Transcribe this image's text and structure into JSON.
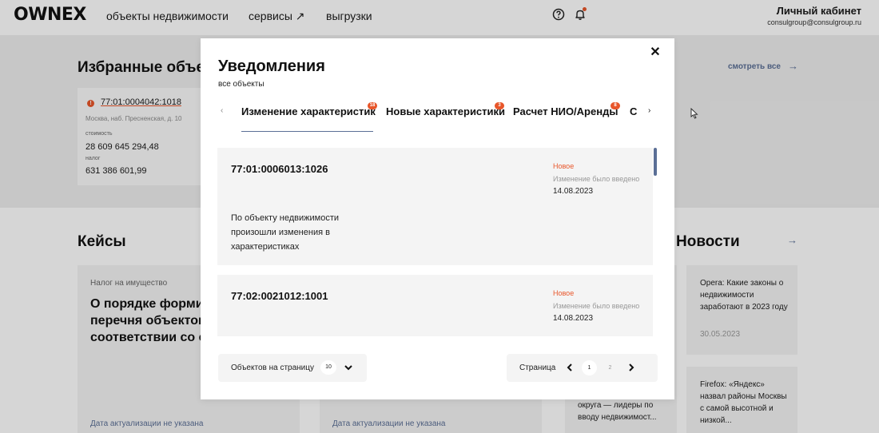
{
  "header": {
    "logo": "OWNEX",
    "nav": [
      "объекты недвижимости",
      "сервисы ↗",
      "выгрузки"
    ],
    "cabinet_title": "Личный кабинет",
    "cabinet_email": "consulgroup@consulgroup.ru",
    "icons": [
      "help-circle-icon",
      "bell-icon"
    ]
  },
  "favorites": {
    "title": "Избранные объекты",
    "see_all": "смотреть все",
    "card": {
      "cadastral": "77:01:0004042:1018",
      "address": "Москва, наб. Пресненская, д. 10",
      "cost_label": "стоимость",
      "cost": "28 609 645 294,48",
      "tax_label": "налог",
      "tax": "631 386 601,99"
    }
  },
  "cases": {
    "title": "Кейсы",
    "cards": [
      {
        "tag": "Налог на имущество",
        "text": "О порядке формирования перечня объектов, в соответствии со статьей",
        "date": "Дата актуализации не указана"
      },
      {
        "tag": "",
        "text": "",
        "date": "Дата актуализации не указана"
      },
      {
        "text": "округа — лидеры по вводу недвижимост..."
      }
    ]
  },
  "news": {
    "title": "Новости",
    "cards": [
      {
        "text": "Opera: Какие законы о недвижимости заработают в 2023 году",
        "date": "30.05.2023"
      },
      {
        "text": "Firefox: «Яндекс» назвал районы Москвы с самой высотной и низкой..."
      }
    ]
  },
  "modal": {
    "title": "Уведомления",
    "subtitle": "все объекты",
    "tabs": [
      {
        "label": "Изменение характеристик",
        "badge": "18",
        "active": true
      },
      {
        "label": "Новые характеристики",
        "badge": "3"
      },
      {
        "label": "Расчет НИО/Аренды",
        "badge": "8"
      },
      {
        "label": "С"
      }
    ],
    "notifications": [
      {
        "cadastral": "77:01:0006013:1026",
        "status": "Новое",
        "change_label": "Изменение было введено",
        "date": "14.08.2023",
        "text": "По объекту недвижимости произошли изменения в характеристиках"
      },
      {
        "cadastral": "77:02:0021012:1001",
        "status": "Новое",
        "change_label": "Изменение было введено",
        "date": "14.08.2023"
      }
    ],
    "per_page_label": "Объектов на страницу",
    "per_page_value": "10",
    "page_label": "Страница",
    "pages": [
      "1",
      "2"
    ],
    "current_page": "1"
  },
  "colors": {
    "accent": "#e8562a",
    "link": "#5b6f96",
    "card_bg": "#f4f4f4",
    "section_bg": "#eeeeee"
  }
}
